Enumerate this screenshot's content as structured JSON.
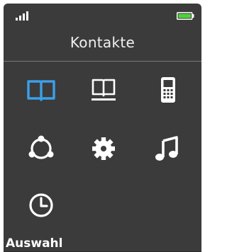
{
  "header": {
    "title": "Kontakte"
  },
  "status": {
    "signal_icon": "signal-bars-icon",
    "battery_icon": "battery-full-icon",
    "battery_color": "#4fd13b"
  },
  "menu": {
    "selected_color": "#3aa0e8",
    "icon_color": "#ffffff",
    "items": [
      {
        "icon": "phonebook-icon",
        "selected": true
      },
      {
        "icon": "phonebook-list-icon",
        "selected": false
      },
      {
        "icon": "mobile-phone-icon",
        "selected": false
      },
      {
        "icon": "network-icon",
        "selected": false
      },
      {
        "icon": "settings-gear-icon",
        "selected": false
      },
      {
        "icon": "music-note-icon",
        "selected": false
      },
      {
        "icon": "clock-icon",
        "selected": false
      }
    ]
  },
  "softkeys": {
    "left": "Auswahl"
  }
}
